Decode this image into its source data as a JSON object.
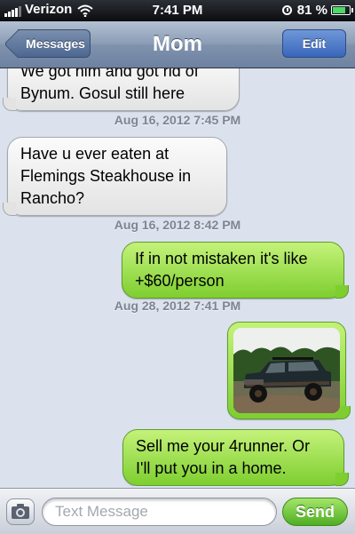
{
  "status_bar": {
    "carrier": "Verizon",
    "time": "7:41 PM",
    "battery_percent": "81 %",
    "battery_level": 0.81
  },
  "nav": {
    "back_label": "Messages",
    "title": "Mom",
    "edit_label": "Edit"
  },
  "messages": [
    {
      "type": "incoming",
      "text": "We got him and got rid of\nBynum.  Gosul still here"
    },
    {
      "type": "timestamp",
      "text": "Aug 16, 2012 7:45 PM"
    },
    {
      "type": "incoming",
      "text": "Have u ever eaten at\nFlemings Steakhouse in\nRancho?"
    },
    {
      "type": "timestamp",
      "text": "Aug 16, 2012 8:42 PM"
    },
    {
      "type": "outgoing",
      "text": "If in not mistaken it's like\n+$60/person"
    },
    {
      "type": "timestamp",
      "text": "Aug 28, 2012 7:41 PM"
    },
    {
      "type": "outgoing-photo",
      "description": "photo of a dark 4runner truck"
    },
    {
      "type": "outgoing",
      "text": "Sell me your 4runner. Or\nI'll put you in a home."
    }
  ],
  "composer": {
    "placeholder": "Text Message",
    "value": "",
    "send_label": "Send"
  },
  "icons": {
    "camera": "camera-icon",
    "wifi": "wifi-icon",
    "alarm": "alarm-clock-icon",
    "battery": "battery-icon",
    "signal": "signal-bars-icon"
  },
  "colors": {
    "incoming_bubble": "#e9e9e9",
    "outgoing_bubble": "#9ede4c",
    "background": "#dbe2ed",
    "nav_bar": "#7f92ad",
    "edit_button": "#3866bb",
    "send_button": "#4fae22"
  }
}
